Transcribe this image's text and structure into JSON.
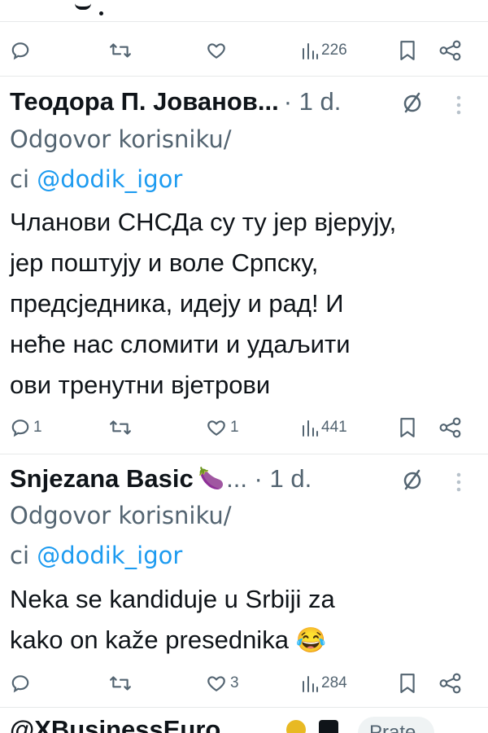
{
  "prev_tweet": {
    "actions": {
      "reply_count": "",
      "retweet_count": "",
      "like_count": "",
      "views": "226"
    }
  },
  "tweets": [
    {
      "author": "Теодора П. Јованов...",
      "meta": "· 1 d.",
      "reply_prefix": "Odgovor korisniku/",
      "reply_prefix2": "ci ",
      "reply_handle": "@dodik_igor",
      "body_lines": [
        "Чланови СНСДа су ту јер вјерују,",
        "јер поштују и воле Српску,",
        "предсједника, идеју и рад! И",
        "неће нас сломити и удаљити",
        "ови тренутни вјетрови"
      ],
      "actions": {
        "reply_count": "1",
        "retweet_count": "",
        "like_count": "1",
        "views": "441"
      }
    },
    {
      "author": "Snjezana Basic",
      "author_emoji": "🍆",
      "meta": "... · 1 d.",
      "reply_prefix": "Odgovor korisniku/",
      "reply_prefix2": "ci ",
      "reply_handle": "@dodik_igor",
      "body_lines": [
        "Neka se kandiduje u Srbiji za",
        "kako on kaže presednika"
      ],
      "body_emoji": "😂",
      "actions": {
        "reply_count": "",
        "retweet_count": "",
        "like_count": "3",
        "views": "284"
      }
    }
  ],
  "next_tweet": {
    "handle": "@XBusinessEuro",
    "follow_label": "Prate"
  },
  "colors": {
    "text": "#0f1419",
    "secondary": "#536471",
    "link": "#1d9bf0",
    "separator": "#e7e9ea"
  },
  "icons": [
    "reply-icon",
    "retweet-icon",
    "like-icon",
    "views-icon",
    "bookmark-icon",
    "share-icon",
    "grok-icon",
    "more-icon"
  ]
}
